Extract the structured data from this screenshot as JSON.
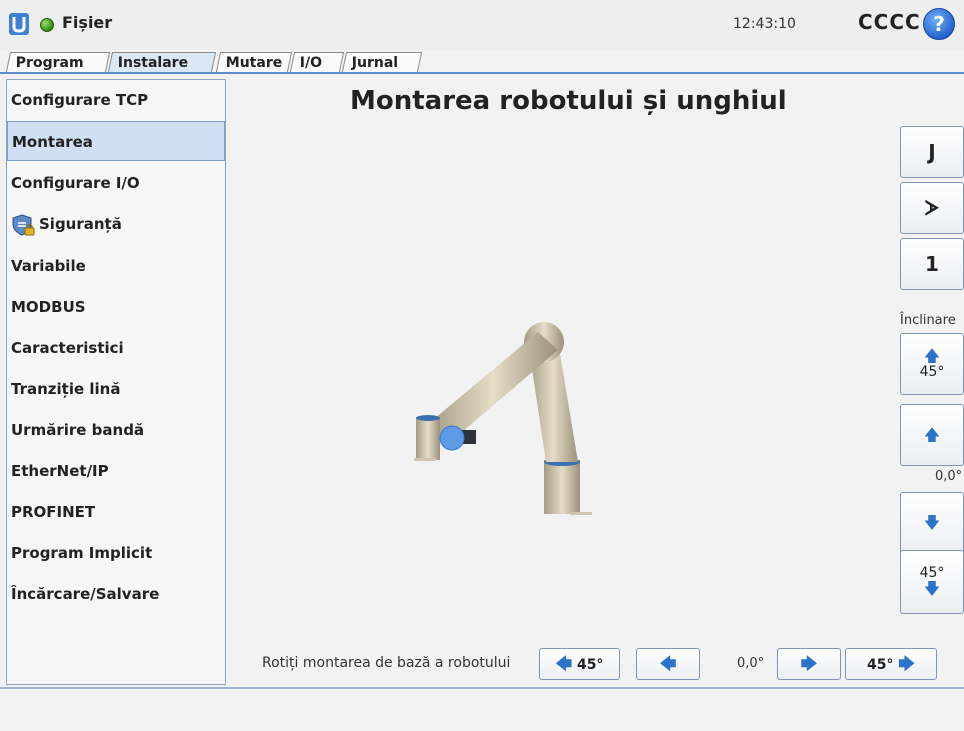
{
  "header": {
    "file_menu": "Fișier",
    "time": "12:43:10",
    "robot_name": "CCCC",
    "help": "?"
  },
  "tabs": [
    {
      "label": "Program"
    },
    {
      "label": "Instalare",
      "active": true
    },
    {
      "label": "Mutare"
    },
    {
      "label": "I/O"
    },
    {
      "label": "Jurnal"
    }
  ],
  "sidebar": {
    "items": [
      {
        "label": "Configurare TCP"
      },
      {
        "label": "Montarea",
        "selected": true
      },
      {
        "label": "Configurare I/O"
      },
      {
        "label": "Siguranță"
      },
      {
        "label": "Variabile"
      },
      {
        "label": "MODBUS"
      },
      {
        "label": "Caracteristici"
      },
      {
        "label": "Tranziție lină"
      },
      {
        "label": "Urmărire bandă"
      },
      {
        "label": "EtherNet/IP"
      },
      {
        "label": "PROFINET"
      },
      {
        "label": "Program Implicit"
      },
      {
        "label": "Încărcare/Salvare"
      }
    ]
  },
  "main": {
    "title": "Montarea robotului și unghiul",
    "view_buttons": [
      "J",
      "ᗆ",
      "1"
    ],
    "tilt": {
      "label": "Înclinare",
      "up45": "45°",
      "down45": "45°",
      "value": "0,0°"
    },
    "rotate": {
      "label": "Rotiți montarea de bază a robotului",
      "left45": "45°",
      "right45": "45°",
      "value": "0,0°"
    }
  },
  "colors": {
    "accent": "#2b73c8",
    "selected_bg": "#cfe0f4",
    "status_green": "#2f8a12"
  }
}
